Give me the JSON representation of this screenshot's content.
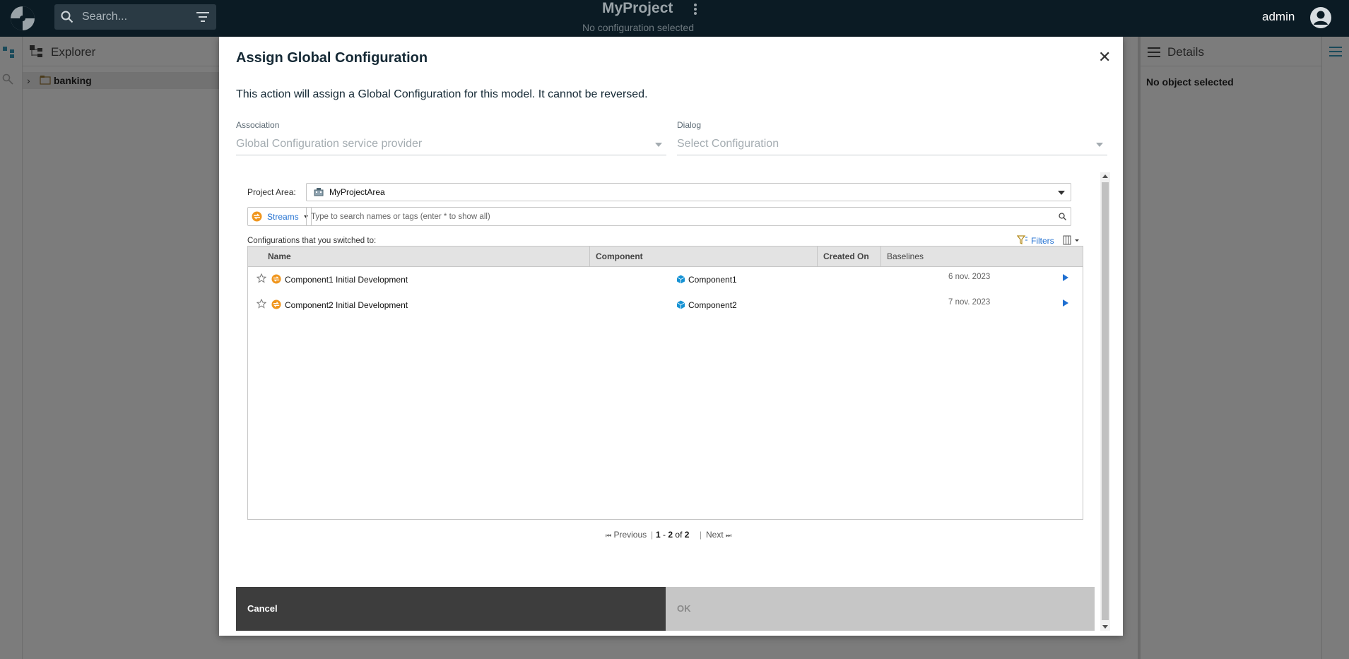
{
  "topbar": {
    "search_placeholder": "Search...",
    "project_name": "MyProject",
    "config_status": "No configuration selected",
    "user": "admin"
  },
  "explorer": {
    "title": "Explorer",
    "tree_item": "banking"
  },
  "details": {
    "title": "Details",
    "empty_text": "No object selected"
  },
  "dialog": {
    "title": "Assign Global Configuration",
    "description": "This action will assign a Global Configuration for this model. It cannot be reversed.",
    "association": {
      "label": "Association",
      "value": "Global Configuration service provider"
    },
    "dialog_field": {
      "label": "Dialog",
      "value": "Select Configuration"
    },
    "picker": {
      "project_area_label": "Project Area:",
      "project_area_value": "MyProjectArea",
      "type_selector": "Streams",
      "search_placeholder": "Type to search names or tags (enter * to show all)",
      "switched_label": "Configurations that you switched to:",
      "filters_label": "Filters",
      "columns": [
        "Name",
        "Component",
        "Created On",
        "Baselines"
      ],
      "rows": [
        {
          "name": "Component1 Initial Development",
          "component": "Component1",
          "created": "6 nov. 2023"
        },
        {
          "name": "Component2 Initial Development",
          "component": "Component2",
          "created": "7 nov. 2023"
        }
      ],
      "pager": {
        "previous": "Previous",
        "range_start": "1",
        "range_end": "2",
        "of": "of",
        "total": "2",
        "next": "Next"
      }
    },
    "cancel_label": "Cancel",
    "ok_label": "OK"
  },
  "colors": {
    "topbar_bg": "#0b1b24",
    "link_blue": "#1f6fd1",
    "stream_orange": "#f0961e",
    "component_blue": "#1592d4",
    "cancel_bg": "#3d3d3d",
    "ok_disabled_bg": "#c6c6c6"
  },
  "icons": {
    "stream": "stream-icon",
    "component": "component-cube-icon",
    "favorite": "star-outline-icon",
    "expand": "play-arrow-icon"
  }
}
